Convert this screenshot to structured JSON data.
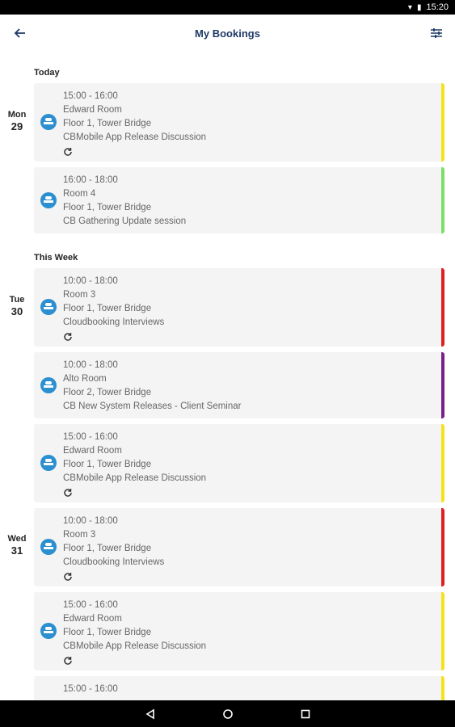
{
  "status_bar": {
    "time": "15:20"
  },
  "app_bar": {
    "title": "My Bookings"
  },
  "sections": [
    {
      "label": "Today"
    },
    {
      "label": "This Week"
    }
  ],
  "days": [
    {
      "dow": "Mon",
      "dom": "29"
    },
    {
      "dow": "Tue",
      "dom": "30"
    },
    {
      "dow": "Wed",
      "dom": "31"
    }
  ],
  "bookings": [
    {
      "time": "15:00 - 16:00",
      "room": "Edward Room",
      "location": "Floor 1, Tower Bridge",
      "title": "CBMobile App Release Discussion",
      "recurring": true,
      "color": "#f5e21b"
    },
    {
      "time": "16:00 - 18:00",
      "room": "Room 4",
      "location": "Floor 1, Tower Bridge",
      "title": "CB Gathering Update session",
      "recurring": false,
      "color": "#7ddc6a"
    },
    {
      "time": "10:00 - 18:00",
      "room": "Room 3",
      "location": "Floor 1, Tower Bridge",
      "title": "Cloudbooking Interviews",
      "recurring": true,
      "color": "#e02020"
    },
    {
      "time": "10:00 - 18:00",
      "room": "Alto Room",
      "location": "Floor 2, Tower Bridge",
      "title": "CB New System Releases - Client Seminar",
      "recurring": false,
      "color": "#7a1f8a"
    },
    {
      "time": "15:00 - 16:00",
      "room": "Edward Room",
      "location": "Floor 1, Tower Bridge",
      "title": "CBMobile App Release Discussion",
      "recurring": true,
      "color": "#f5e21b"
    },
    {
      "time": "10:00 - 18:00",
      "room": "Room 3",
      "location": "Floor 1, Tower Bridge",
      "title": "Cloudbooking Interviews",
      "recurring": true,
      "color": "#e02020"
    },
    {
      "time": "15:00 - 16:00",
      "room": "Edward Room",
      "location": "Floor 1, Tower Bridge",
      "title": "CBMobile App Release Discussion",
      "recurring": true,
      "color": "#f5e21b"
    },
    {
      "time": "15:00 - 16:00",
      "room": "",
      "location": "",
      "title": "",
      "recurring": false,
      "color": "#f5e21b"
    }
  ]
}
